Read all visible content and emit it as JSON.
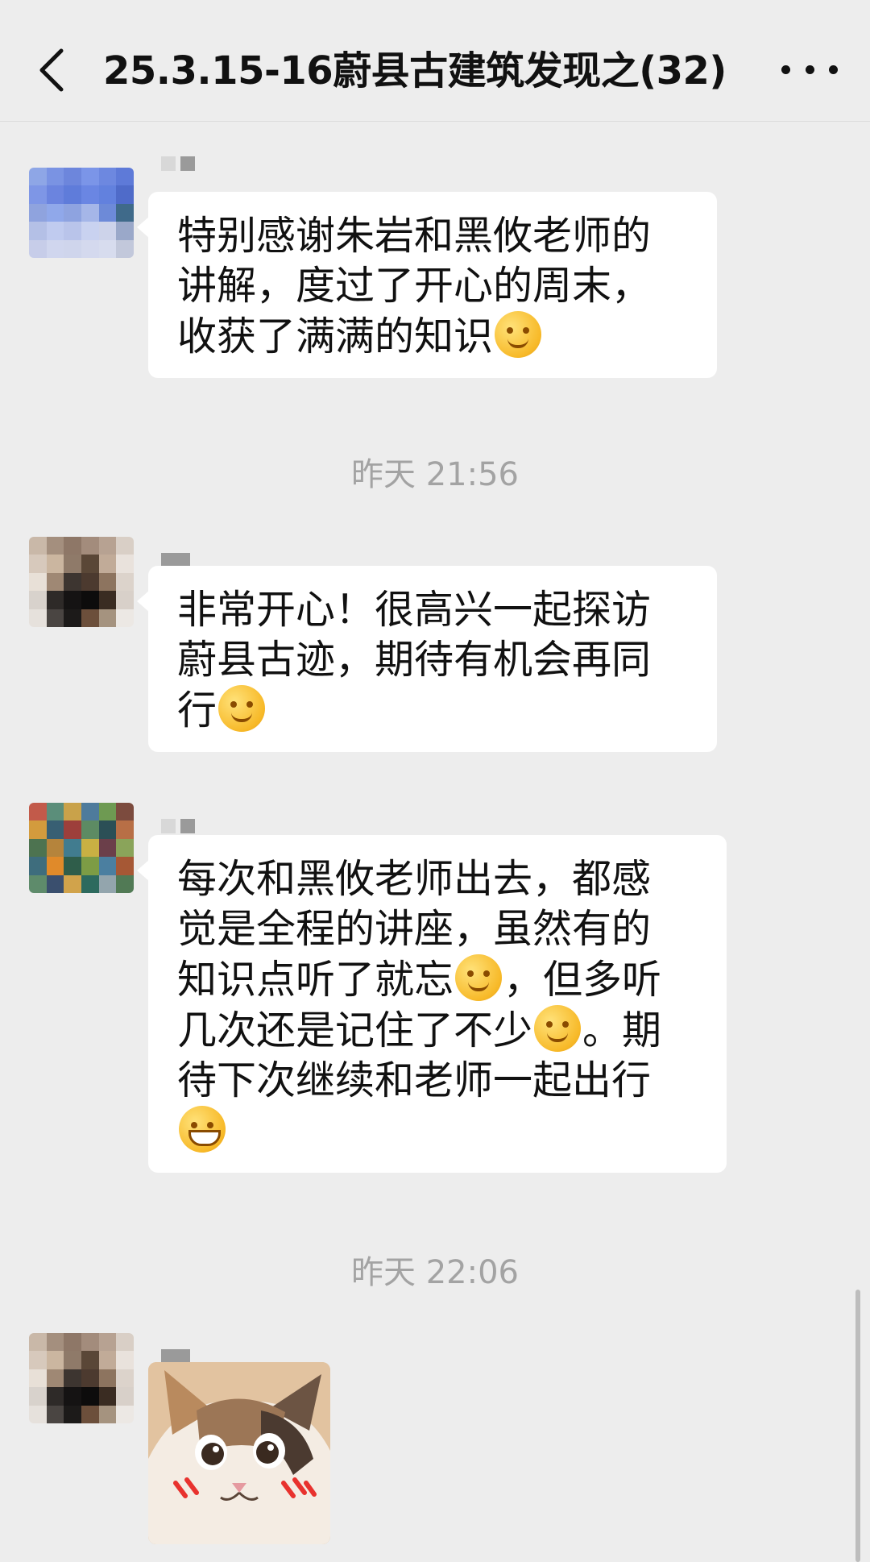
{
  "header": {
    "title": "25.3.15-16蔚县古建筑发现之",
    "member_count": "(32)"
  },
  "messages": [
    {
      "text_lines": [
        "特别感谢朱岩和黑攸老师的",
        "讲解，度过了开心的周末，",
        "收获了满满的知识"
      ],
      "emojis": [
        "shy-emoji"
      ]
    },
    {
      "text_lines": [
        "非常开心！很高兴一起探访",
        "蔚县古迹，期待有机会再同",
        "行"
      ],
      "emojis": [
        "smile-emoji"
      ]
    },
    {
      "text_lines": [
        "每次和黑攸老师出去，都感",
        "觉是全程的讲座，虽然有的",
        "知识点听了就忘",
        "，但多听",
        "几次还是记住了不少",
        "。期",
        "待下次继续和老师一起出行"
      ],
      "emojis": [
        "thinking-emoji",
        "thinking-emoji",
        "grin-emoji"
      ]
    }
  ],
  "timestamps": [
    "昨天 21:56",
    "昨天 22:06"
  ],
  "colors": {
    "background": "#ededed",
    "bubble": "#ffffff",
    "timestamp": "#a3a3a3"
  }
}
